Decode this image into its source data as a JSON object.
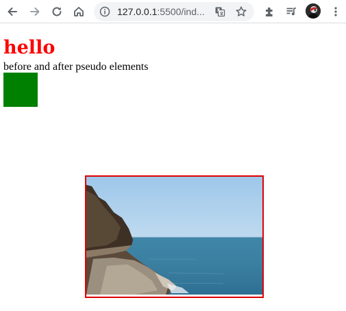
{
  "browser": {
    "url_host": "127.0.0.1",
    "url_rest": ":5500/ind..."
  },
  "icons": [
    "back-arrow-icon",
    "forward-arrow-icon",
    "reload-icon",
    "home-icon",
    "info-icon",
    "translate-icon",
    "star-icon",
    "extensions-icon",
    "media-playlist-icon",
    "profile-avatar",
    "menu-dots-icon"
  ],
  "page": {
    "heading": "hello",
    "paragraph": "before and after pseudo elements",
    "box_color": "#008000",
    "heading_color": "#ff0000",
    "image_border_color": "#e00000"
  }
}
